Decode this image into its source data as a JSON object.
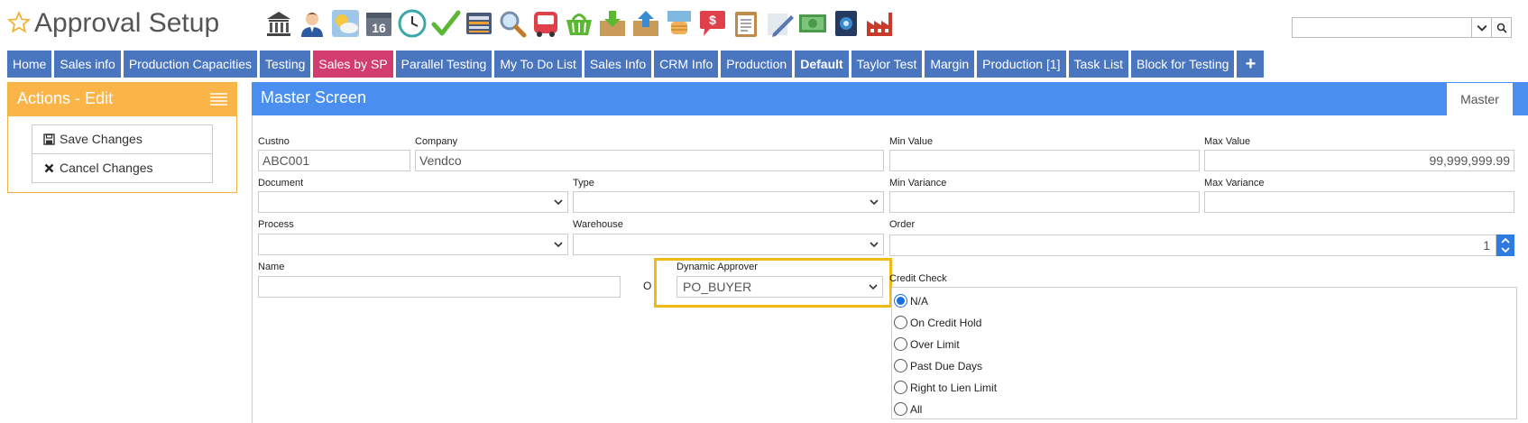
{
  "header": {
    "title": "Approval Setup",
    "toolbar_icons": [
      "bank-icon",
      "user-icon",
      "weather-icon",
      "calendar-icon",
      "clock-icon",
      "checkmark-icon",
      "keyboard-icon",
      "magnifier-icon",
      "bus-icon",
      "basket-icon",
      "inbox-download-icon",
      "outbox-upload-icon",
      "money-hand-icon",
      "price-tag-icon",
      "clipboard-icon",
      "pencil-icon",
      "cash-icon",
      "safe-icon",
      "factory-icon"
    ],
    "calendar_day": "16"
  },
  "search": {
    "value": "",
    "placeholder": ""
  },
  "tabs": [
    {
      "label": "Home",
      "active": false,
      "bold": false
    },
    {
      "label": "Sales info",
      "active": false,
      "bold": false
    },
    {
      "label": "Production Capacities",
      "active": false,
      "bold": false
    },
    {
      "label": "Testing",
      "active": false,
      "bold": false
    },
    {
      "label": "Sales by SP",
      "active": true,
      "bold": false
    },
    {
      "label": "Parallel Testing",
      "active": false,
      "bold": false
    },
    {
      "label": "My To Do List",
      "active": false,
      "bold": false
    },
    {
      "label": "Sales Info",
      "active": false,
      "bold": false
    },
    {
      "label": "CRM Info",
      "active": false,
      "bold": false
    },
    {
      "label": "Production",
      "active": false,
      "bold": false
    },
    {
      "label": "Default",
      "active": false,
      "bold": true
    },
    {
      "label": "Taylor Test",
      "active": false,
      "bold": false
    },
    {
      "label": "Margin",
      "active": false,
      "bold": false
    },
    {
      "label": "Production [1]",
      "active": false,
      "bold": false
    },
    {
      "label": "Task List",
      "active": false,
      "bold": false
    },
    {
      "label": "Block for Testing",
      "active": false,
      "bold": false
    }
  ],
  "actions": {
    "title": "Actions - Edit",
    "save_label": "Save Changes",
    "cancel_label": "Cancel Changes"
  },
  "master": {
    "title": "Master Screen",
    "tab_label": "Master"
  },
  "form": {
    "custno_label": "Custno",
    "custno_value": "ABC001",
    "company_label": "Company",
    "company_value": "Vendco",
    "min_value_label": "Min Value",
    "min_value_value": "",
    "max_value_label": "Max Value",
    "max_value_value": "99,999,999.99",
    "document_label": "Document",
    "document_value": "",
    "type_label": "Type",
    "type_value": "",
    "min_variance_label": "Min Variance",
    "min_variance_value": "",
    "max_variance_label": "Max Variance",
    "max_variance_value": "",
    "process_label": "Process",
    "process_value": "",
    "warehouse_label": "Warehouse",
    "warehouse_value": "",
    "order_label": "Order",
    "order_value": "1",
    "name_label": "Name",
    "name_value": "",
    "partial_label": "O",
    "dynamic_approver_label": "Dynamic Approver",
    "dynamic_approver_value": "PO_BUYER",
    "credit_check_label": "Credit Check",
    "credit_options": [
      {
        "label": "N/A",
        "checked": true
      },
      {
        "label": "On Credit Hold",
        "checked": false
      },
      {
        "label": "Over Limit",
        "checked": false
      },
      {
        "label": "Past Due Days",
        "checked": false
      },
      {
        "label": "Right to Lien Limit",
        "checked": false
      },
      {
        "label": "All",
        "checked": false
      }
    ]
  },
  "colors": {
    "tab": "#4a76c0",
    "tab_active": "#d33c6f",
    "actions_header": "#fbb447",
    "master_header": "#4a8ef0",
    "highlight": "#f1b913"
  }
}
